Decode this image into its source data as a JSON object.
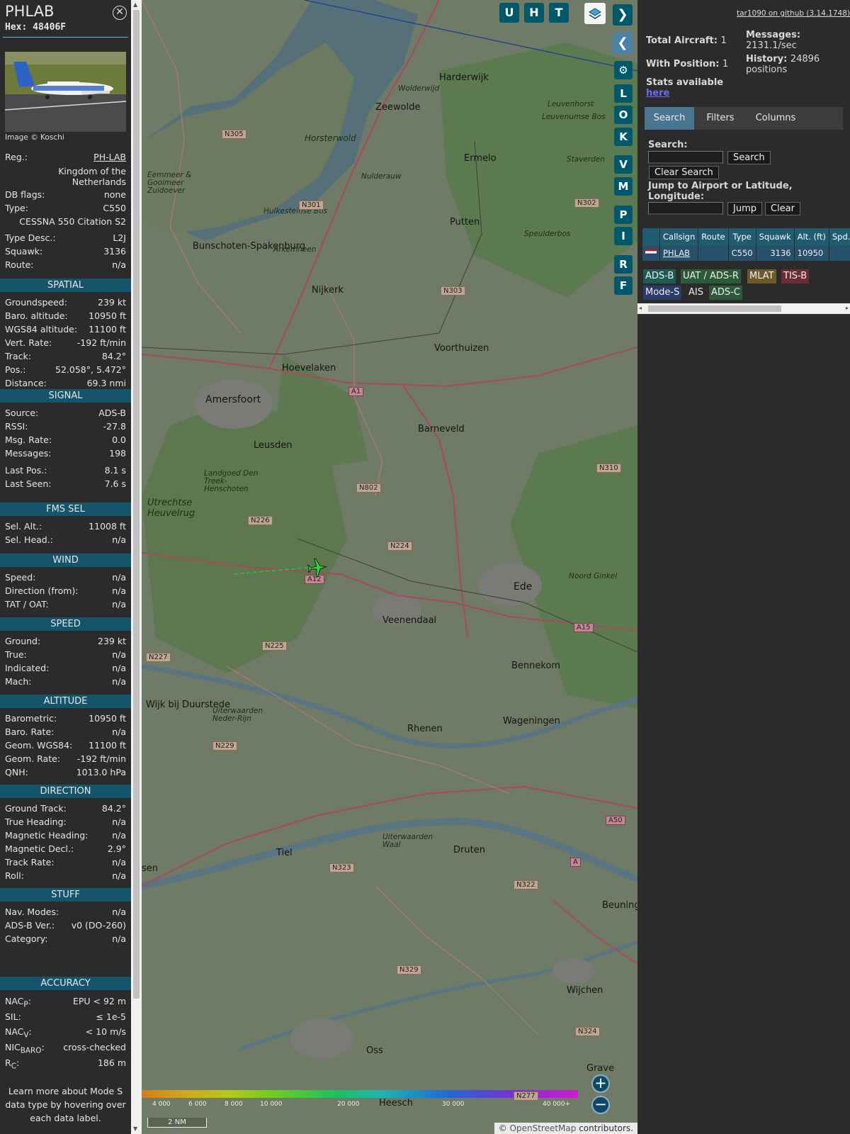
{
  "aircraft": {
    "callsign": "PHLAB",
    "hex_label": "Hex:",
    "hex": "48406F",
    "image_credit": "Image © Koschi"
  },
  "details": [
    {
      "label": "Reg.:",
      "value": "PH-LAB"
    },
    {
      "label": "Country",
      "value": "Kingdom of the Netherlands"
    },
    {
      "label": "DB flags:",
      "value": "none"
    },
    {
      "label": "Type:",
      "value": "C550"
    },
    {
      "label": "Model",
      "value": "CESSNA 550 Citation S2"
    },
    {
      "label": "Type Desc.:",
      "value": "L2J"
    },
    {
      "label": "Squawk:",
      "value": "3136"
    },
    {
      "label": "Route:",
      "value": "n/a"
    }
  ],
  "sections": [
    {
      "title": "SPATIAL",
      "rows": [
        {
          "label": "Groundspeed:",
          "value": "239 kt"
        },
        {
          "label": "Baro. altitude:",
          "value": "10950 ft"
        },
        {
          "label": "WGS84 altitude:",
          "value": "11100 ft"
        },
        {
          "label": "Vert. Rate:",
          "value": "-192 ft/min"
        },
        {
          "label": "Track:",
          "value": "84.2°"
        },
        {
          "label": "Pos.:",
          "value": "52.058°, 5.472°"
        },
        {
          "label": "Distance:",
          "value": "69.3 nmi"
        }
      ]
    },
    {
      "title": "SIGNAL",
      "rows": [
        {
          "label": "Source:",
          "value": "ADS-B"
        },
        {
          "label": "RSSI:",
          "value": "-27.8"
        },
        {
          "label": "Msg. Rate:",
          "value": "0.0"
        },
        {
          "label": "Messages:",
          "value": "198"
        },
        {
          "label": "Last Pos.:",
          "value": "8.1 s"
        },
        {
          "label": "Last Seen:",
          "value": "7.6 s"
        }
      ]
    },
    {
      "title": "FMS SEL",
      "rows": [
        {
          "label": "Sel. Alt.:",
          "value": "11008 ft"
        },
        {
          "label": "Sel. Head.:",
          "value": "n/a"
        }
      ]
    },
    {
      "title": "WIND",
      "rows": [
        {
          "label": "Speed:",
          "value": "n/a"
        },
        {
          "label": "Direction (from):",
          "value": "n/a"
        },
        {
          "label": "TAT / OAT:",
          "value": "n/a"
        }
      ]
    },
    {
      "title": "SPEED",
      "rows": [
        {
          "label": "Ground:",
          "value": "239 kt"
        },
        {
          "label": "True:",
          "value": "n/a"
        },
        {
          "label": "Indicated:",
          "value": "n/a"
        },
        {
          "label": "Mach:",
          "value": "n/a"
        }
      ]
    },
    {
      "title": "ALTITUDE",
      "rows": [
        {
          "label": "Barometric:",
          "value": "10950 ft"
        },
        {
          "label": "Baro. Rate:",
          "value": "n/a"
        },
        {
          "label": "Geom. WGS84:",
          "value": "11100 ft"
        },
        {
          "label": "Geom. Rate:",
          "value": "-192 ft/min"
        },
        {
          "label": "QNH:",
          "value": "1013.0 hPa"
        }
      ]
    },
    {
      "title": "DIRECTION",
      "rows": [
        {
          "label": "Ground Track:",
          "value": "84.2°"
        },
        {
          "label": "True Heading:",
          "value": "n/a"
        },
        {
          "label": "Magnetic Heading:",
          "value": "n/a"
        },
        {
          "label": "Magnetic Decl.:",
          "value": "2.9°"
        },
        {
          "label": "Track Rate:",
          "value": "n/a"
        },
        {
          "label": "Roll:",
          "value": "n/a"
        }
      ]
    },
    {
      "title": "STUFF",
      "rows": [
        {
          "label": "Nav. Modes:",
          "value": "n/a"
        },
        {
          "label": "ADS-B Ver.:",
          "value": "v0 (DO-260)"
        },
        {
          "label": "Category:",
          "value": "n/a"
        }
      ]
    }
  ],
  "accuracy": {
    "title": "ACCURACY",
    "nacp": {
      "label": "NAC",
      "sub": "P",
      "value": "EPU < 92 m"
    },
    "sil": {
      "label": "SIL:",
      "value": "≤ 1e-5"
    },
    "nacv": {
      "label": "NAC",
      "sub": "V",
      "value": "< 10 m/s"
    },
    "nicbaro": {
      "label": "NIC",
      "sub": "BARO",
      "value": "cross-checked"
    },
    "rc": {
      "label": "R",
      "sub": "C",
      "value": "186 m"
    }
  },
  "learn_more": "Learn more about Mode S data type by hovering over each data label.",
  "map": {
    "top_buttons": [
      "U",
      "H",
      "T"
    ],
    "side_buttons": [
      "L",
      "O",
      "K",
      "V",
      "M",
      "P",
      "I",
      "R",
      "F"
    ],
    "places": [
      "Harderwijk",
      "Zeewolde",
      "Horsterwold",
      "Ermelo",
      "Putten",
      "Bunschoten-Spakenburg",
      "Nijkerk",
      "Hoevelaken",
      "Voorthuizen",
      "Amersfoort",
      "Leusden",
      "Barneveld",
      "Ede",
      "Veenendaal",
      "Bennekom",
      "Wijk bij Duurstede",
      "Rhenen",
      "Wageningen",
      "Tiel",
      "Druten",
      "Wijchen",
      "Oss",
      "Heesch",
      "Beuninge",
      "Grave",
      "Eemmeer & Gooimeer Zuidoever",
      "Utrechtse Heuvelrug",
      "Uiterwaarden Neder-Rijn",
      "Uiterwaarden Waal",
      "Leuvenumse Bos",
      "Speulderbos",
      "Staverden",
      "Nulderauw",
      "Hulkesteinse Bos",
      "Arkemheen",
      "Landgoed Den Treek-Henschoten",
      "Noord Ginkel",
      "Leuvenhorst",
      "Wolderwijd",
      "sen"
    ],
    "roads": [
      "N305",
      "N301",
      "N302",
      "N303",
      "N310",
      "N802",
      "N226",
      "N224",
      "N225",
      "N227",
      "N229",
      "N323",
      "N322",
      "N329",
      "N324",
      "N277",
      "A1",
      "A12",
      "A15",
      "A50",
      "A"
    ],
    "altitude_scale": [
      "4 000",
      "6 000",
      "8 000",
      "10 000",
      "20 000",
      "30 000",
      "40 000+"
    ],
    "scale": "2 NM",
    "attribution_prefix": "© ",
    "attribution_link": "OpenStreetMap",
    "attribution_suffix": " contributors."
  },
  "right": {
    "github": "tar1090 on github (3.14.1748)",
    "total_aircraft_label": "Total Aircraft:",
    "total_aircraft": "1",
    "with_position_label": "With Position:",
    "with_position": "1",
    "stats_text": "Stats available",
    "stats_link": "here",
    "messages_label": "Messages:",
    "messages_value": "2131.1/sec",
    "history_label": "History:",
    "history_value": "24896",
    "history_unit": "positions",
    "tabs": [
      "Search",
      "Filters",
      "Columns"
    ],
    "search_label": "Search:",
    "search_button": "Search",
    "clear_search_button": "Clear Search",
    "jump_label": "Jump to Airport or Latitude, Longitude:",
    "jump_button": "Jump",
    "clear_button": "Clear",
    "columns": [
      "Callsign",
      "Route",
      "Type",
      "Squawk",
      "Alt. (ft)",
      "Spd."
    ],
    "rows": [
      {
        "callsign": "PHLAB",
        "route": "",
        "type": "C550",
        "squawk": "3136",
        "alt": "10950",
        "spd": ""
      }
    ],
    "legend": [
      {
        "label": "ADS-B",
        "color": "#1f5b53"
      },
      {
        "label": "UAT / ADS-R",
        "color": "#2d5a3a"
      },
      {
        "label": "MLAT",
        "color": "#6b5a2a"
      },
      {
        "label": "TIS-B",
        "color": "#6b2c33"
      },
      {
        "label": "Mode-S",
        "color": "#2d3b6a"
      },
      {
        "label": "AIS",
        "color": "#2b2b2b"
      },
      {
        "label": "ADS-C",
        "color": "#2d5a3a"
      }
    ]
  }
}
